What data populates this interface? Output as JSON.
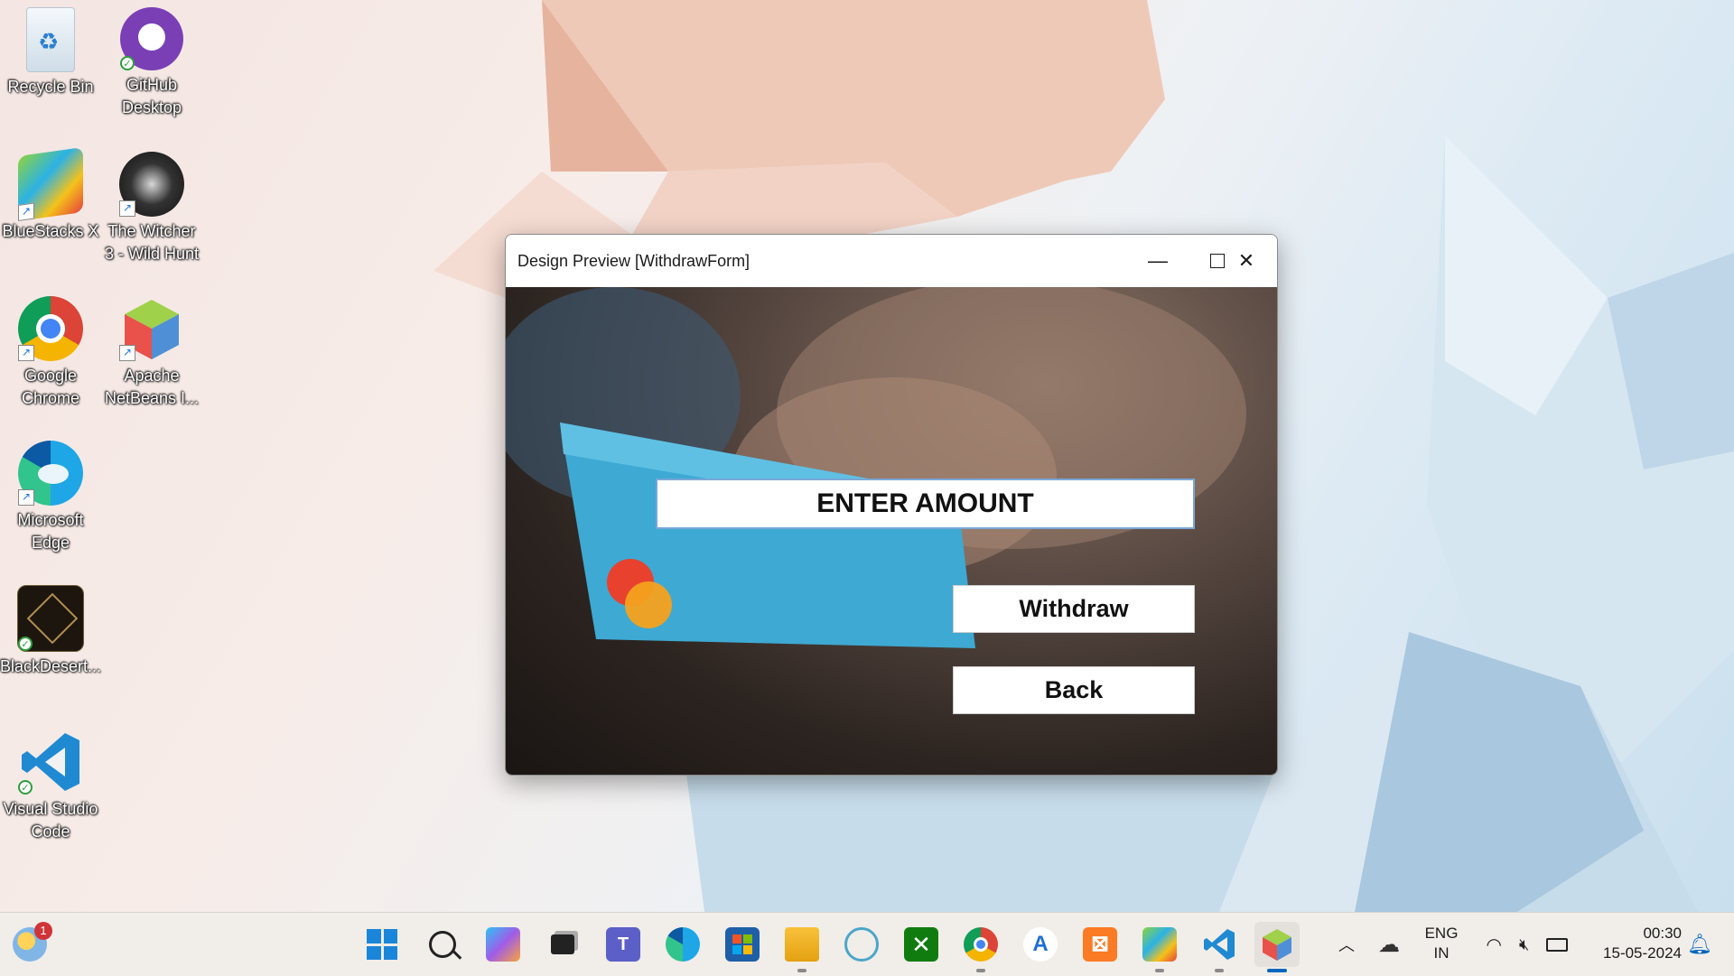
{
  "desktop": {
    "icons": [
      {
        "label": "Recycle Bin"
      },
      {
        "label": "GitHub Desktop"
      },
      {
        "label": "BlueStacks X"
      },
      {
        "label": "The Witcher 3 - Wild Hunt"
      },
      {
        "label": "Google Chrome"
      },
      {
        "label": "Apache NetBeans I..."
      },
      {
        "label": "Microsoft Edge"
      },
      {
        "label": "BlackDesert..."
      },
      {
        "label": "Visual Studio Code"
      }
    ]
  },
  "window": {
    "title": "Design Preview [WithdrawForm]",
    "minimize_icon": "minimize-icon",
    "maximize_icon": "maximize-icon",
    "close_icon": "close-icon",
    "form": {
      "amount_field": "ENTER AMOUNT",
      "withdraw_button": "Withdraw",
      "back_button": "Back"
    }
  },
  "taskbar": {
    "weather_badge": "1",
    "apps": [
      "start-icon",
      "search-icon",
      "copilot-icon",
      "task-view-icon",
      "teams-icon",
      "edge-icon",
      "store-icon",
      "file-explorer-icon",
      "app-icon",
      "xbox-icon",
      "chrome-icon",
      "app-icon",
      "xampp-icon",
      "bluestacks-icon",
      "vscode-icon",
      "netbeans-icon"
    ],
    "tray": {
      "lang_top": "ENG",
      "lang_bottom": "IN",
      "time": "00:30",
      "date": "15-05-2024"
    }
  },
  "colors": {
    "accent": "#0067c0",
    "taskbar_bg": "#f1ede9"
  }
}
